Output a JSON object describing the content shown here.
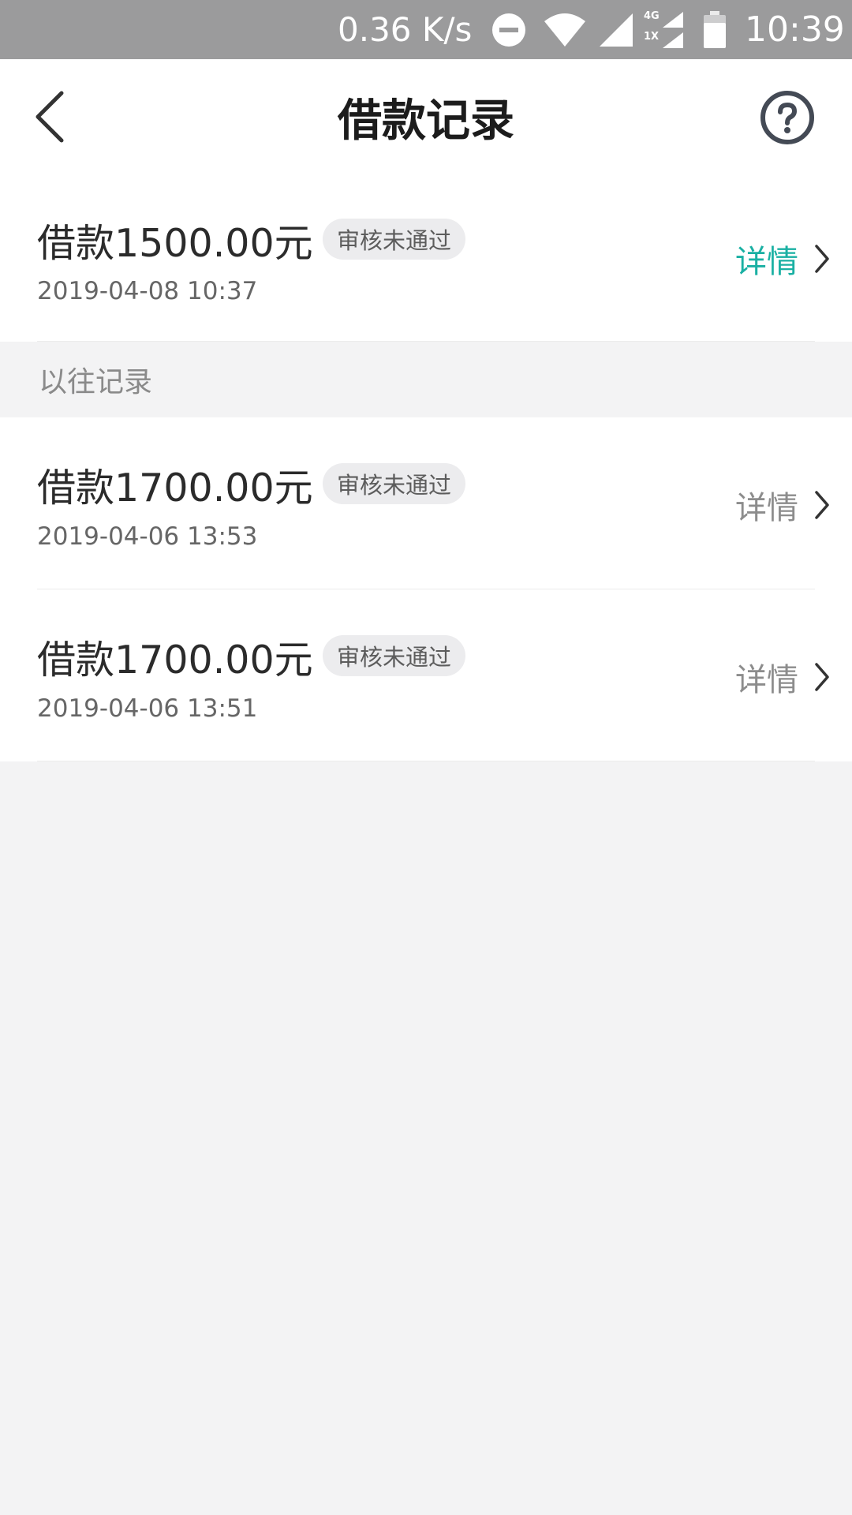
{
  "status_bar": {
    "net_speed": "0.36 K/s",
    "network_type_top": "4G",
    "network_type_bottom": "1X",
    "time": "10:39",
    "icons": [
      "dnd-icon",
      "wifi-icon",
      "signal-icon",
      "signal-4g-1x-icon",
      "battery-icon"
    ]
  },
  "nav": {
    "title": "借款记录",
    "back_icon": "chevron-left-icon",
    "help_icon": "help-circle-icon"
  },
  "current_record": {
    "amount": "借款1500.00元",
    "status": "审核未通过",
    "datetime": "2019-04-08 10:37",
    "detail_label": "详情",
    "detail_color": "#1ab0a3"
  },
  "history": {
    "header": "以往记录",
    "records": [
      {
        "amount": "借款1700.00元",
        "status": "审核未通过",
        "datetime": "2019-04-06 13:53",
        "detail_label": "详情"
      },
      {
        "amount": "借款1700.00元",
        "status": "审核未通过",
        "datetime": "2019-04-06 13:51",
        "detail_label": "详情"
      }
    ],
    "detail_color": "#8c8c8c"
  },
  "colors": {
    "status_bar_bg": "#9b9b9c",
    "accent": "#1ab0a3",
    "page_bg": "#f3f3f4"
  }
}
